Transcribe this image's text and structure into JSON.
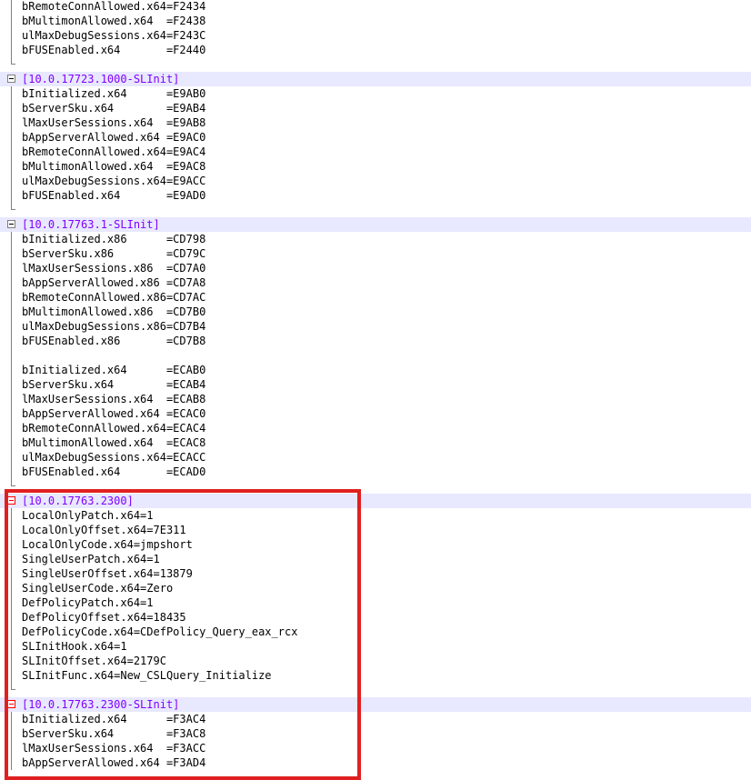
{
  "editor": {
    "lines": [
      "bRemoteConnAllowed.x64=F2434",
      "bMultimonAllowed.x64  =F2438",
      "ulMaxDebugSessions.x64=F243C",
      "bFUSEnabled.x64       =F2440",
      "",
      "[10.0.17723.1000-SLInit]",
      "bInitialized.x64      =E9AB0",
      "bServerSku.x64        =E9AB4",
      "lMaxUserSessions.x64  =E9AB8",
      "bAppServerAllowed.x64 =E9AC0",
      "bRemoteConnAllowed.x64=E9AC4",
      "bMultimonAllowed.x64  =E9AC8",
      "ulMaxDebugSessions.x64=E9ACC",
      "bFUSEnabled.x64       =E9AD0",
      "",
      "[10.0.17763.1-SLInit]",
      "bInitialized.x86      =CD798",
      "bServerSku.x86        =CD79C",
      "lMaxUserSessions.x86  =CD7A0",
      "bAppServerAllowed.x86 =CD7A8",
      "bRemoteConnAllowed.x86=CD7AC",
      "bMultimonAllowed.x86  =CD7B0",
      "ulMaxDebugSessions.x86=CD7B4",
      "bFUSEnabled.x86       =CD7B8",
      "",
      "bInitialized.x64      =ECAB0",
      "bServerSku.x64        =ECAB4",
      "lMaxUserSessions.x64  =ECAB8",
      "bAppServerAllowed.x64 =ECAC0",
      "bRemoteConnAllowed.x64=ECAC4",
      "bMultimonAllowed.x64  =ECAC8",
      "ulMaxDebugSessions.x64=ECACC",
      "bFUSEnabled.x64       =ECAD0",
      "",
      "[10.0.17763.2300]",
      "LocalOnlyPatch.x64=1",
      "LocalOnlyOffset.x64=7E311",
      "LocalOnlyCode.x64=jmpshort",
      "SingleUserPatch.x64=1",
      "SingleUserOffset.x64=13879",
      "SingleUserCode.x64=Zero",
      "DefPolicyPatch.x64=1",
      "DefPolicyOffset.x64=18435",
      "DefPolicyCode.x64=CDefPolicy_Query_eax_rcx",
      "SLInitHook.x64=1",
      "SLInitOffset.x64=2179C",
      "SLInitFunc.x64=New_CSLQuery_Initialize",
      "",
      "[10.0.17763.2300-SLInit]",
      "bInitialized.x64      =F3AC4",
      "bServerSku.x64        =F3AC8",
      "lMaxUserSessions.x64  =F3ACC",
      "bAppServerAllowed.x64 =F3AD4"
    ],
    "section_color": "#8000ff",
    "highlight_color": "#e8e8ff",
    "annotation_box_color": "#e02020"
  }
}
